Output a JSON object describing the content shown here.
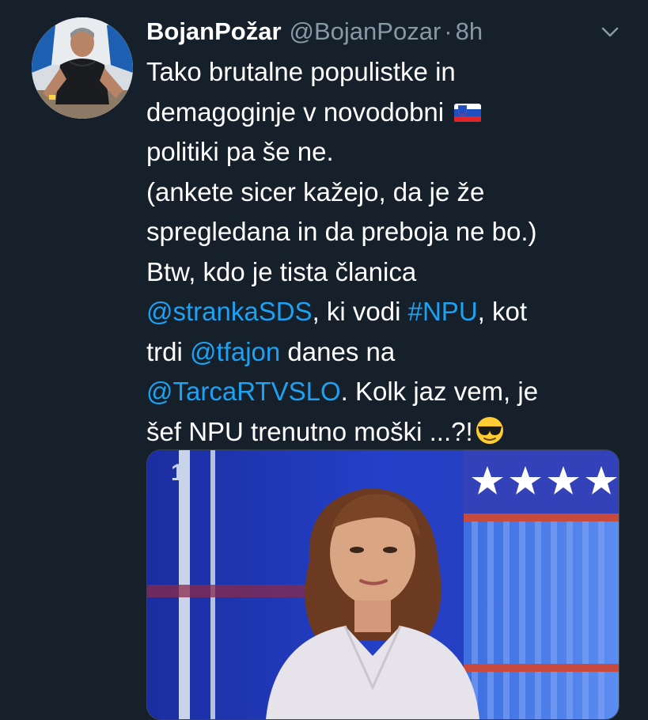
{
  "tweet": {
    "author_name": "BojanPožar",
    "author_handle": "@BojanPozar",
    "separator": "·",
    "time": "8h",
    "avatar_icon": "profile-photo",
    "more_icon": "chevron-down-icon",
    "text_lines": [
      "Tako brutalne populistke in",
      "demagoginje v novodobni",
      "politiki pa še ne.",
      "(ankete sicer kažejo, da je že",
      "spregledana in da preboja ne bo.)",
      "Btw, kdo je tista članica"
    ],
    "mention_stranka": "@strankaSDS",
    "after_stranka": ", ki vodi ",
    "hashtag_npu": "#NPU",
    "after_npu": ", kot",
    "trdi": "trdi ",
    "mention_tfajon": "@tfajon",
    "after_tfajon": " danes na",
    "mention_tarca": "@TarcaRTVSLO",
    "after_tarca": ". Kolk jaz vem, je",
    "last_line": "šef NPU trenutno moški ...?!",
    "flag_emoji": "slovenia-flag",
    "end_emoji": "sunglasses-emoji"
  },
  "media": {
    "type": "image",
    "channel_logo": "1"
  },
  "colors": {
    "background": "#15202b",
    "link": "#1da1f2",
    "muted": "#8899a6"
  }
}
